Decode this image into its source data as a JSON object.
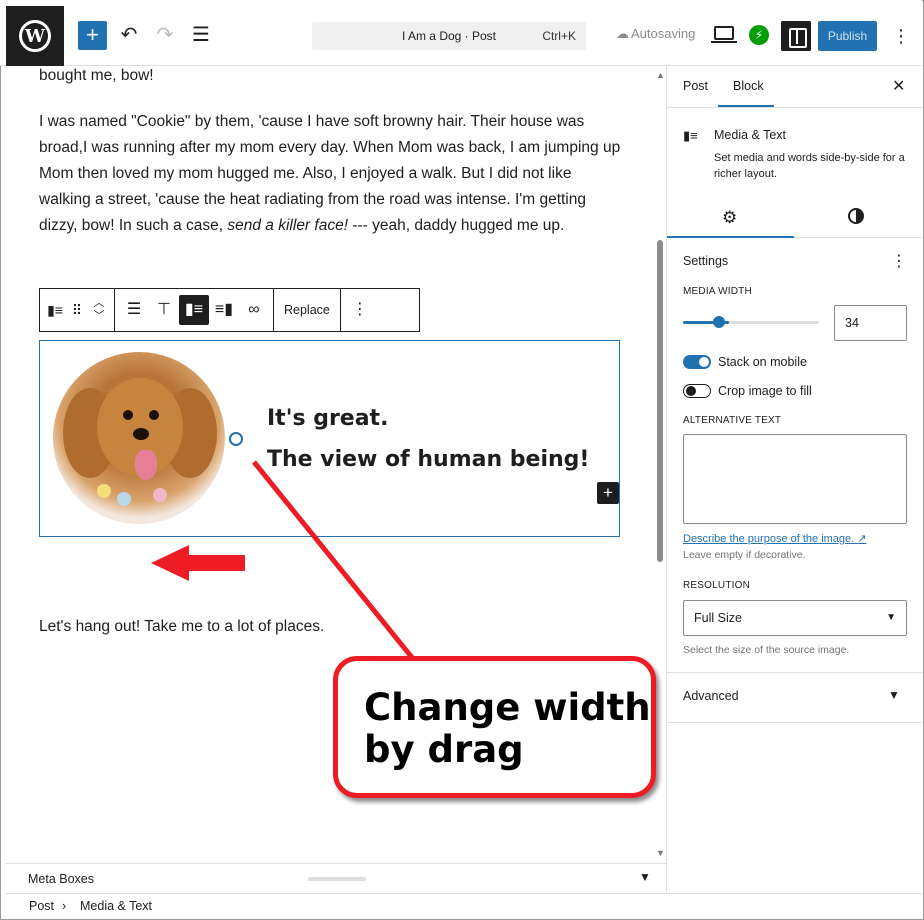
{
  "topbar": {
    "logo": "wordpress-logo",
    "document_title": "I Am a Dog · Post",
    "shortcut": "Ctrl+K",
    "autosave_label": "Autosaving",
    "publish_label": "Publish",
    "accent": "#2271b1"
  },
  "editor": {
    "para_top": "bought me, bow!",
    "para_main_before": "I was named \"Cookie\" by them, 'cause I have soft browny hair. Their house was broad,I was running after my mom every day. When Mom was back, I am jumping up Mom then loved my mom hugged me. Also, I enjoyed a walk. But I did not like walking a street, 'cause the heat radiating from the road was intense. I'm getting dizzy, bow! In such a case, ",
    "para_main_em": "send a killer face!",
    "para_main_after": " --- yeah, daddy hugged me up.",
    "toolbar": {
      "replace_label": "Replace"
    },
    "media_text": {
      "heading_1": "It's great.",
      "heading_2": "The view of human being!"
    },
    "para_bottom": "Let's hang out! Take me to a lot of places."
  },
  "annotation": {
    "line_1": "Change width",
    "line_2": "by drag",
    "color": "#ee1c25"
  },
  "meta_boxes": {
    "label": "Meta Boxes"
  },
  "breadcrumb": {
    "item_1": "Post",
    "separator": "›",
    "item_2": "Media & Text"
  },
  "sidebar": {
    "tab_post": "Post",
    "tab_block": "Block",
    "block_name": "Media & Text",
    "block_description": "Set media and words side-by-side for a richer layout.",
    "settings_title": "Settings",
    "media_width_label": "MEDIA WIDTH",
    "media_width_value": "34",
    "media_width_fraction": 0.34,
    "stack_on_mobile_label": "Stack on mobile",
    "stack_on_mobile": true,
    "crop_label": "Crop image to fill",
    "crop": false,
    "alt_text_label": "ALTERNATIVE TEXT",
    "alt_link": "Describe the purpose of the image.",
    "alt_hint": "Leave empty if decorative.",
    "resolution_label": "RESOLUTION",
    "resolution_value": "Full Size",
    "resolution_hint": "Select the size of the source image.",
    "advanced_label": "Advanced"
  }
}
